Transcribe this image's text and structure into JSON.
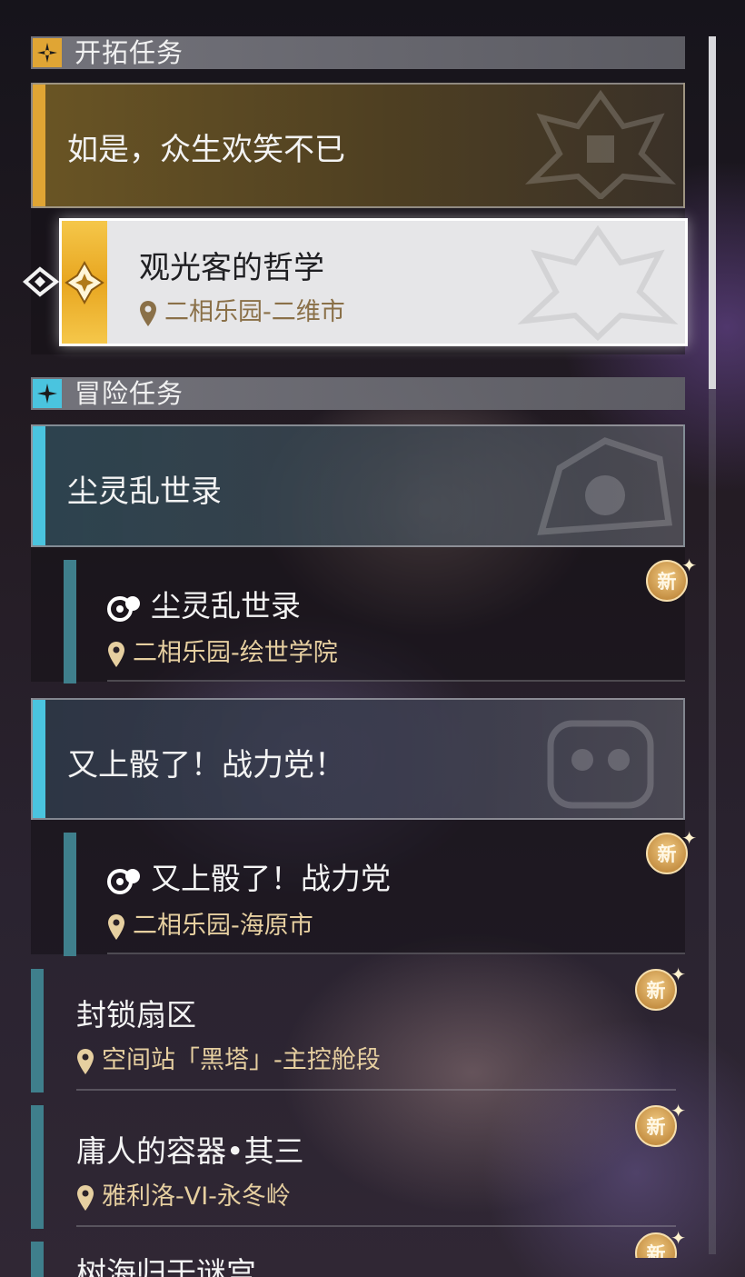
{
  "trailblaze": {
    "header": "开拓任务",
    "mission_title": "如是，众生欢笑不已",
    "selected_quest": {
      "title": "观光客的哲学",
      "location": "二相乐园-二维市"
    }
  },
  "adventure": {
    "header": "冒险任务",
    "groups": [
      {
        "title": "尘灵乱世录",
        "quest_title": "尘灵乱世录",
        "location": "二相乐园-绘世学院",
        "badge": "新"
      },
      {
        "title": "又上骰了！战力党！",
        "quest_title": "又上骰了！战力党",
        "location": "二相乐园-海原市",
        "badge": "新"
      }
    ],
    "quests": [
      {
        "title": "封锁扇区",
        "location": "空间站「黑塔」-主控舱段",
        "badge": "新"
      },
      {
        "title": "庸人的容器•其三",
        "location": "雅利洛-VI-永冬岭",
        "badge": "新"
      },
      {
        "title": "树海归于谜宫",
        "badge": "新"
      }
    ]
  },
  "colors": {
    "trailblaze_accent": "#e0a534",
    "adventure_accent": "#4ac4df",
    "subquest_stripe": "#3f7f8c",
    "location_text": "#e6cfa0",
    "selected_location_text": "#8a7048"
  },
  "icons": [
    "trailblaze-star-icon",
    "adventure-star-icon",
    "pointer-arrow-icon",
    "location-pin-icon",
    "quest-type-icon",
    "new-badge-icon"
  ]
}
